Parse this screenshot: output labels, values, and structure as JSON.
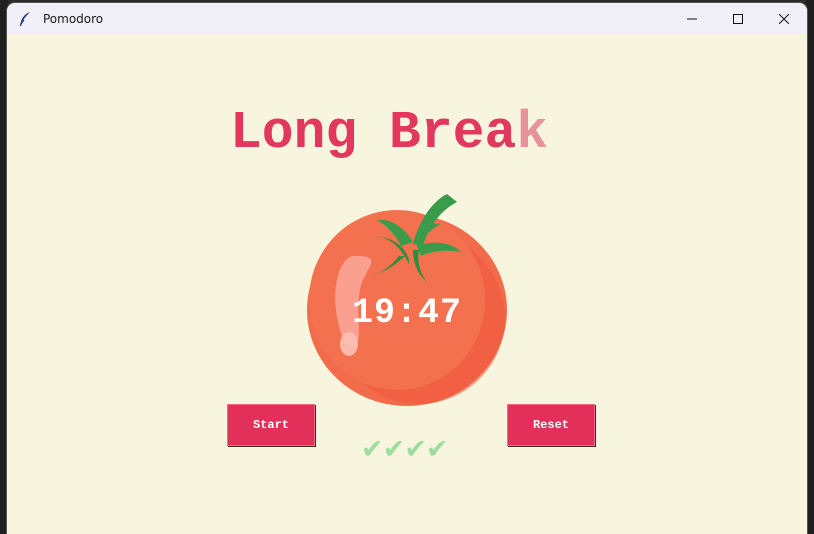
{
  "window": {
    "title": "Pomodoro",
    "app_icon": "feather-icon",
    "controls": [
      "minimize-icon",
      "maximize-icon",
      "close-icon"
    ]
  },
  "heading": {
    "main": "Long Brea",
    "last_char": "k",
    "color": "#e2385f",
    "faded_color": "#e7929c"
  },
  "timer": {
    "value": "19:47"
  },
  "buttons": {
    "start_label": "Start",
    "reset_label": "Reset",
    "color": "#e2305b"
  },
  "checkmarks": {
    "text": "✔✔✔✔",
    "color": "#9ddd9f"
  },
  "colors": {
    "background": "#f7f5dd",
    "tomato": "#f26b4a",
    "leaf": "#3a9c4a"
  }
}
